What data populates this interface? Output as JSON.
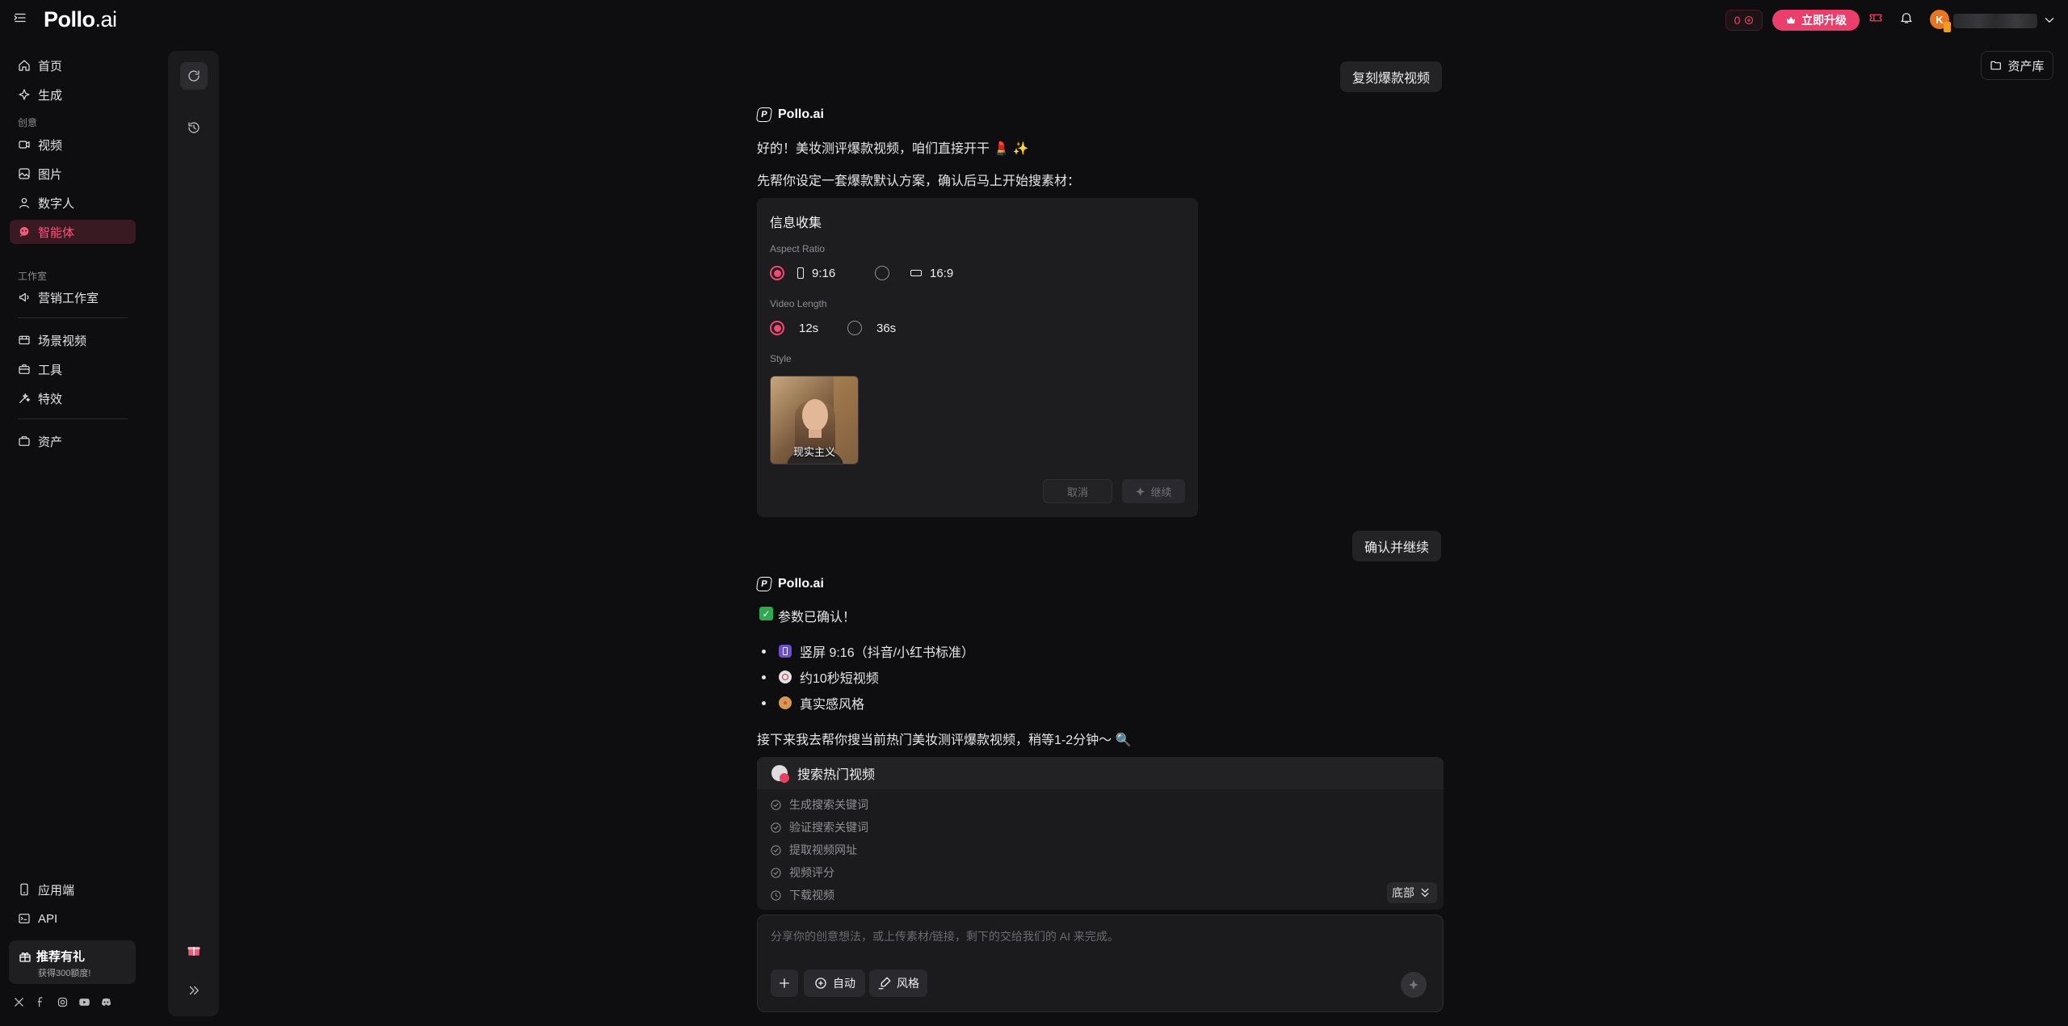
{
  "app": {
    "logo_main": "Pollo",
    "logo_suffix": ".ai"
  },
  "topbar": {
    "credits": "0",
    "upgrade_label": "立即升级",
    "avatar_letter": "K",
    "accent": "#ea3f6d"
  },
  "sidebar": {
    "items": [
      {
        "label": "首页",
        "icon": "home-icon"
      },
      {
        "label": "生成",
        "icon": "sparkle-icon"
      },
      {
        "label": "视频",
        "icon": "video-icon"
      },
      {
        "label": "图片",
        "icon": "image-icon"
      },
      {
        "label": "数字人",
        "icon": "avatar-icon"
      },
      {
        "label": "智能体",
        "icon": "agent-icon",
        "active": true
      },
      {
        "label": "营销工作室",
        "icon": "megaphone-icon"
      },
      {
        "label": "场景视频",
        "icon": "scene-icon"
      },
      {
        "label": "工具",
        "icon": "toolbox-icon"
      },
      {
        "label": "特效",
        "icon": "effects-icon"
      },
      {
        "label": "资产",
        "icon": "assets-icon"
      },
      {
        "label": "应用端",
        "icon": "app-icon"
      },
      {
        "label": "API",
        "icon": "api-icon"
      }
    ],
    "sections": {
      "create": "创意",
      "studio": "工作室"
    },
    "promo": {
      "title": "推荐有礼",
      "subtitle": "获得300额度!"
    }
  },
  "library_label": "资产库",
  "chat": {
    "user_msg_1": "复刻爆款视频",
    "agent_name": "Pollo.ai",
    "agent_msg_1": "好的！美妆测评爆款视频，咱们直接开干 💄 ✨",
    "agent_msg_2": "先帮你设定一套爆款默认方案，确认后马上开始搜素材：",
    "form": {
      "title": "信息收集",
      "aspect_label": "Aspect Ratio",
      "aspect_options": [
        "9:16",
        "16:9"
      ],
      "length_label": "Video Length",
      "length_options": [
        "12s",
        "36s"
      ],
      "style_label": "Style",
      "style_option": "现实主义",
      "cancel": "取消",
      "continue": "继续"
    },
    "user_msg_2": "确认并继续",
    "confirmed": "参数已确认！",
    "bullets": [
      "竖屏 9:16（抖音/小红书标准）",
      "约10秒短视频",
      "真实感风格"
    ],
    "agent_msg_3": "接下来我去帮你搜当前热门美妆测评爆款视频，稍等1-2分钟～ 🔍",
    "task": {
      "title": "搜索热门视频",
      "steps": [
        "生成搜索关键词",
        "验证搜索关键词",
        "提取视频网址",
        "视频评分",
        "下载视频"
      ]
    },
    "bottom_label": "底部"
  },
  "composer": {
    "placeholder": "分享你的创意想法，或上传素材/链接，剩下的交给我们的 AI 来完成。",
    "auto_label": "自动",
    "style_label": "风格"
  }
}
